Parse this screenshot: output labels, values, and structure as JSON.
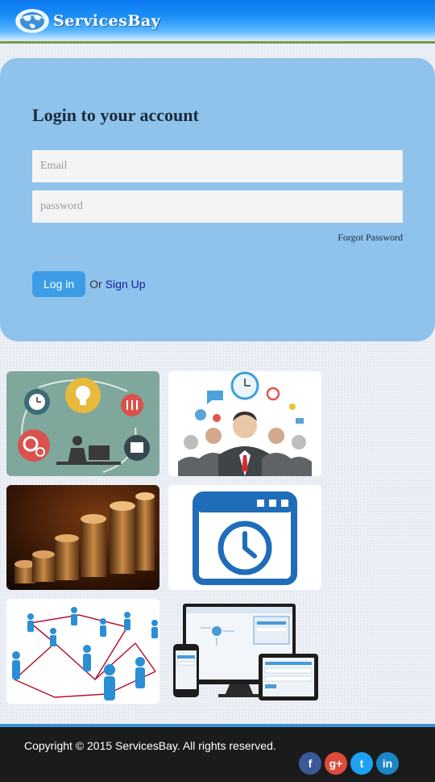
{
  "header": {
    "brand": "ServicesBay"
  },
  "login": {
    "title": "Login to your account",
    "email_placeholder": "Email",
    "password_placeholder": "password",
    "forgot_label": "Forgot Password",
    "login_button": "Log in",
    "or_text": "Or",
    "signup_label": "Sign Up"
  },
  "tiles": [
    {
      "icon": "workflow-idea-illustration"
    },
    {
      "icon": "business-team-illustration"
    },
    {
      "icon": "coin-stacks-photo"
    },
    {
      "icon": "clock-window-icon"
    },
    {
      "icon": "people-network-illustration"
    },
    {
      "icon": "multi-device-screens"
    }
  ],
  "footer": {
    "copyright": "Copyright © 2015 ServicesBay. All rights reserved.",
    "socials": [
      {
        "name": "facebook",
        "glyph": "f",
        "color": "#3b5998"
      },
      {
        "name": "google-plus",
        "glyph": "g+",
        "color": "#dd4b39"
      },
      {
        "name": "twitter",
        "glyph": "t",
        "color": "#1da1f2"
      },
      {
        "name": "linkedin",
        "glyph": "in",
        "color": "#1b86c6"
      }
    ]
  },
  "colors": {
    "header_blue": "#0a78f0",
    "panel_blue": "#8fc3ec",
    "button_blue": "#3c9de6",
    "footer_dark": "#1b1b1b"
  }
}
